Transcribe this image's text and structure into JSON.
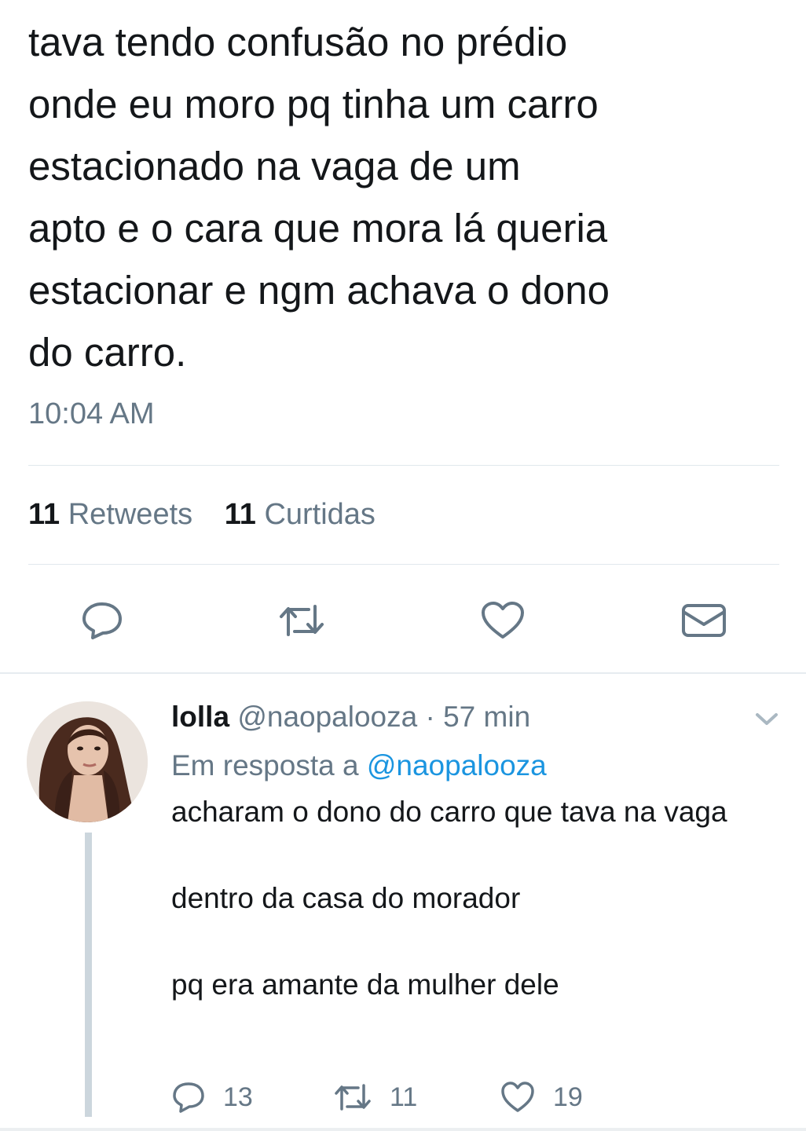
{
  "tweet": {
    "lines": [
      "tava tendo confusão no prédio",
      "onde eu moro pq tinha um carro",
      "estacionado na vaga de um",
      "apto e o cara que mora lá queria",
      "estacionar e ngm achava o dono",
      "do carro."
    ],
    "time": "10:04 AM",
    "retweet_count": "11",
    "retweet_label": "Retweets",
    "like_count": "11",
    "like_label": "Curtidas"
  },
  "actions": [
    "reply-icon",
    "retweet-icon",
    "like-icon",
    "direct-message-icon"
  ],
  "reply": {
    "name": "lolla",
    "handle": "@naopalooza",
    "separator": "·",
    "age": "57 min",
    "in_reply_to_label": "Em resposta a",
    "in_reply_to_handle": "@naopalooza",
    "paragraphs": [
      "acharam o dono do carro que tava na vaga",
      "dentro da casa do morador",
      "pq era amante da mulher dele"
    ],
    "reply_count": "13",
    "retweet_count": "11",
    "like_count": "19"
  },
  "colors": {
    "text": "#14171a",
    "secondary": "#657786",
    "link": "#1b95e0",
    "divider": "#e1e8ed",
    "thread_line": "#ccd6dd"
  }
}
